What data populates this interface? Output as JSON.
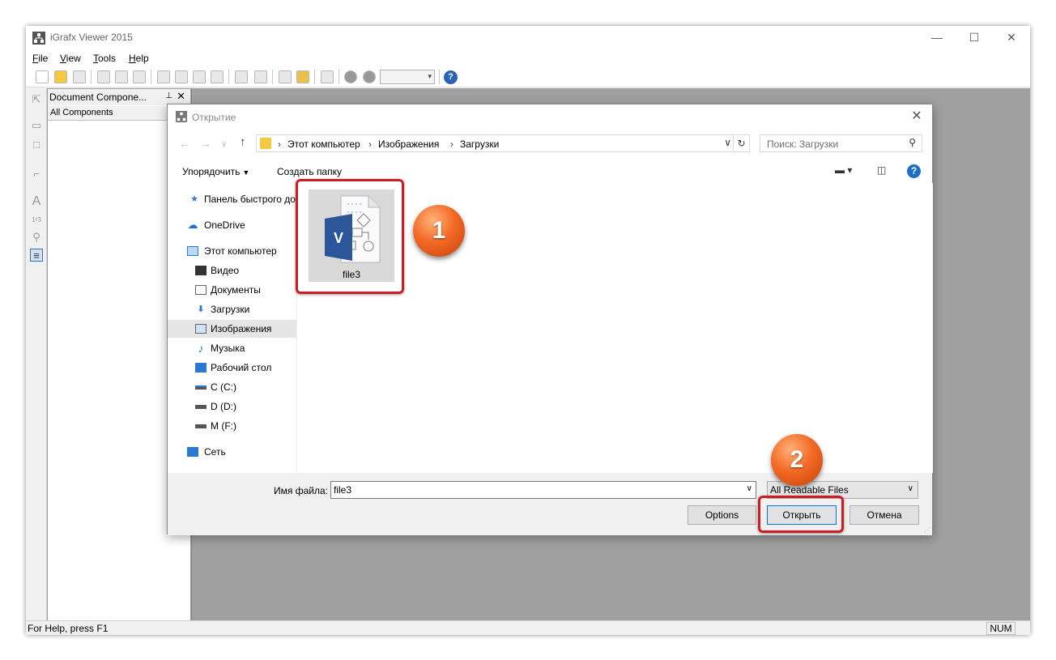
{
  "window": {
    "title": "iGrafx Viewer 2015",
    "min": "—",
    "max": "☐",
    "close": "✕"
  },
  "menu": [
    {
      "accel": "F",
      "rest": "ile"
    },
    {
      "accel": "V",
      "rest": "iew"
    },
    {
      "accel": "T",
      "rest": "ools"
    },
    {
      "accel": "H",
      "rest": "elp"
    }
  ],
  "toolbar": {
    "help": "?"
  },
  "doc_panel": {
    "title": "Document Compone...",
    "pin": "📌",
    "close": "✕",
    "tab": "All Components"
  },
  "status": {
    "help_text": "For Help, press F1",
    "num": "NUM"
  },
  "dialog": {
    "title": "Открытие",
    "close": "✕",
    "address": {
      "crumbs": [
        "Этот компьютер",
        "Изображения",
        "Загрузки"
      ],
      "sep": "›"
    },
    "search_placeholder": "Поиск: Загрузки",
    "organize": "Упорядочить",
    "new_folder": "Создать папку",
    "nav": [
      {
        "label": "Панель быстрого доступа",
        "icon": "star-icon"
      },
      {
        "label": "OneDrive",
        "icon": "cloud-icon"
      },
      {
        "label": "Этот компьютер",
        "icon": "computer-icon"
      },
      {
        "label": "Видео",
        "icon": "video-icon"
      },
      {
        "label": "Документы",
        "icon": "document-icon"
      },
      {
        "label": "Загрузки",
        "icon": "download-icon"
      },
      {
        "label": "Изображения",
        "icon": "pictures-icon",
        "selected": true
      },
      {
        "label": "Музыка",
        "icon": "music-icon"
      },
      {
        "label": "Рабочий стол",
        "icon": "desktop-icon"
      },
      {
        "label": "C (C:)",
        "icon": "drive-icon"
      },
      {
        "label": "D (D:)",
        "icon": "drive-icon"
      },
      {
        "label": "M (F:)",
        "icon": "drive-icon"
      },
      {
        "label": "Сеть",
        "icon": "network-icon"
      }
    ],
    "files": [
      {
        "name": "file3",
        "type": "visio-file-icon"
      }
    ],
    "filename_label": "Имя файла:",
    "filename_value": "file3",
    "filetype_value": "All Readable Files",
    "buttons": {
      "options": "Options",
      "open": "Открыть",
      "cancel": "Отмена"
    }
  },
  "annotations": {
    "step1": "1",
    "step2": "2",
    "highlight_color": "#cc1c24",
    "badge_color": "#f26a25"
  },
  "colors": {
    "visio_blue": "#2b579a",
    "accent": "#0078d7"
  }
}
